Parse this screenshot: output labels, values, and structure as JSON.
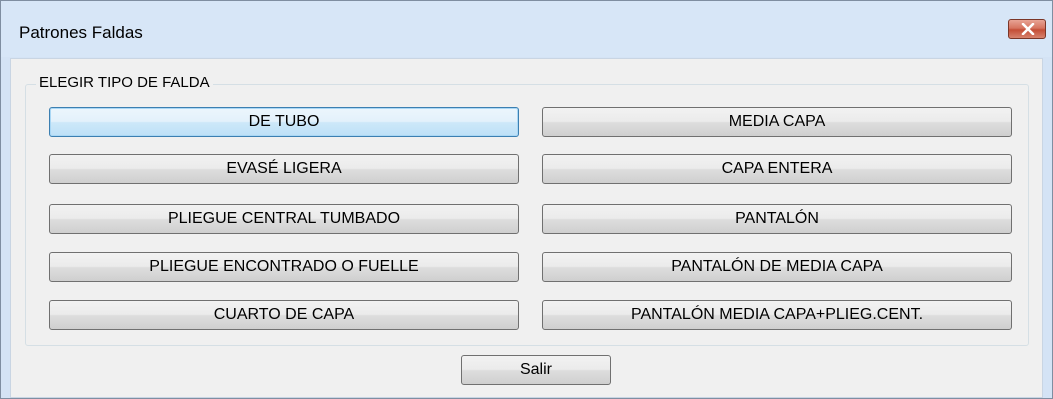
{
  "window": {
    "title": "Patrones Faldas"
  },
  "group": {
    "label": "ELEGIR TIPO DE FALDA"
  },
  "buttons": {
    "left": [
      "DE TUBO",
      "EVASÉ LIGERA",
      "PLIEGUE CENTRAL TUMBADO",
      "PLIEGUE ENCONTRADO O FUELLE",
      "CUARTO DE CAPA"
    ],
    "right": [
      "MEDIA CAPA",
      "CAPA ENTERA",
      "PANTALÓN",
      "PANTALÓN DE MEDIA CAPA",
      "PANTALÓN MEDIA CAPA+PLIEG.CENT."
    ]
  },
  "footer": {
    "exit_label": "Salir"
  },
  "icons": {
    "close": "close-icon"
  },
  "colors": {
    "titlebar": "#d7e6f7",
    "close_button": "#c44e36",
    "focus_border": "#3c7fb1"
  }
}
